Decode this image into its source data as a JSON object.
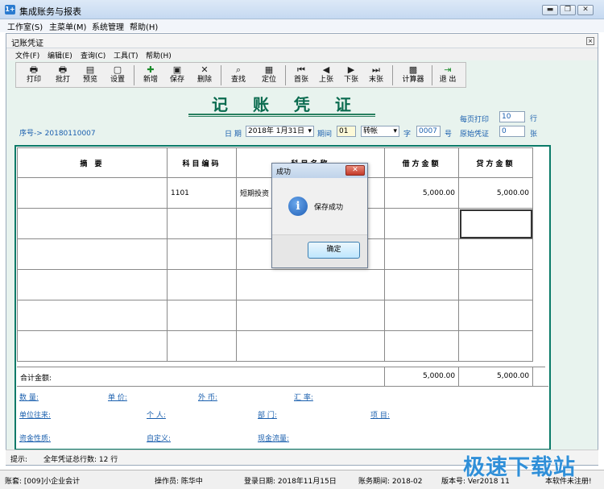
{
  "window": {
    "title": "集成账务与报表",
    "icon": "app-icon",
    "min": "▬",
    "max": "❐",
    "close": "✕"
  },
  "menubar": [
    "工作室(S)",
    "主菜单(M)",
    "系统管理",
    "帮助(H)"
  ],
  "inner": {
    "title": "记账凭证",
    "close": "×",
    "menu": [
      "文件(F)",
      "编辑(E)",
      "查询(C)",
      "工具(T)",
      "帮助(H)"
    ]
  },
  "toolbar": [
    {
      "label": "打印",
      "icon": "print-icon",
      "glyph": "🖶"
    },
    {
      "label": "批打",
      "icon": "batch-print-icon",
      "glyph": "🖶"
    },
    {
      "label": "预览",
      "icon": "preview-icon",
      "glyph": "▤"
    },
    {
      "label": "设置",
      "icon": "settings-icon",
      "glyph": "▢"
    },
    {
      "label": "新增",
      "icon": "add-icon",
      "glyph": "✚"
    },
    {
      "label": "保存",
      "icon": "save-icon",
      "glyph": "▣"
    },
    {
      "label": "删除",
      "icon": "delete-icon",
      "glyph": "✕"
    },
    {
      "label": "查找",
      "icon": "find-icon",
      "glyph": "⌕"
    },
    {
      "label": "定位",
      "icon": "locate-icon",
      "glyph": "▦"
    },
    {
      "label": "首张",
      "icon": "first-icon",
      "glyph": "⏮"
    },
    {
      "label": "上张",
      "icon": "prev-icon",
      "glyph": "◀"
    },
    {
      "label": "下张",
      "icon": "next-icon",
      "glyph": "▶"
    },
    {
      "label": "末张",
      "icon": "last-icon",
      "glyph": "⏭"
    },
    {
      "label": "计算器",
      "icon": "calculator-icon",
      "glyph": "▩"
    },
    {
      "label": "退 出",
      "icon": "exit-icon",
      "glyph": "⇥"
    }
  ],
  "voucher": {
    "title": "记 账 凭 证",
    "serial_label": "序号-> 20180110007",
    "date_label": "日 期",
    "date_value": "2018年 1月31日",
    "period_label": "期间",
    "period_value": "01",
    "type_value": "转帐",
    "zi_label": "字",
    "number_value": "0007",
    "hao_label": "号",
    "per_page_label": "每页打印",
    "per_page_value": "10",
    "hang_label": "行",
    "orig_label": "原始凭证",
    "orig_value": "0",
    "zhang_label": "张",
    "headers": [
      "摘 要",
      "科目编码",
      "科目名称",
      "借方金额",
      "贷方金额"
    ],
    "rows": [
      [
        "",
        "1101",
        "短期投资",
        "5,000.00",
        "5,000.00"
      ],
      [
        "",
        "",
        "",
        "",
        ""
      ],
      [
        "",
        "",
        "",
        "",
        ""
      ],
      [
        "",
        "",
        "",
        "",
        ""
      ],
      [
        "",
        "",
        "",
        "",
        ""
      ],
      [
        "",
        "",
        "",
        "",
        ""
      ]
    ],
    "total_label": "合计金额:",
    "total_debit": "5,000.00",
    "total_credit": "5,000.00",
    "fields": {
      "qty": "数 量:",
      "price": "单 价:",
      "foreign": "外 币:",
      "rate": "汇 率:",
      "unit": "单位往来:",
      "person": "个 人:",
      "dept": "部 门:",
      "project": "项 目:",
      "fund": "资金性质:",
      "custom": "自定义:",
      "cashflow": "现金流量:"
    }
  },
  "dialog": {
    "title": "成功",
    "close": "✕",
    "icon": "info-icon",
    "glyph": "i",
    "message": "保存成功",
    "ok": "确定"
  },
  "hint": {
    "label": "提示:",
    "text": "全年凭证总行数: 12 行"
  },
  "status": {
    "account": "账套: [009]小企业会计",
    "operator": "操作员: 陈华中",
    "login_date": "登录日期: 2018年11月15日",
    "period": "账务期间: 2018-02",
    "version": "版本号: Ver2018 11",
    "reg": "本软件未注册!"
  },
  "watermark": "极速下载站"
}
